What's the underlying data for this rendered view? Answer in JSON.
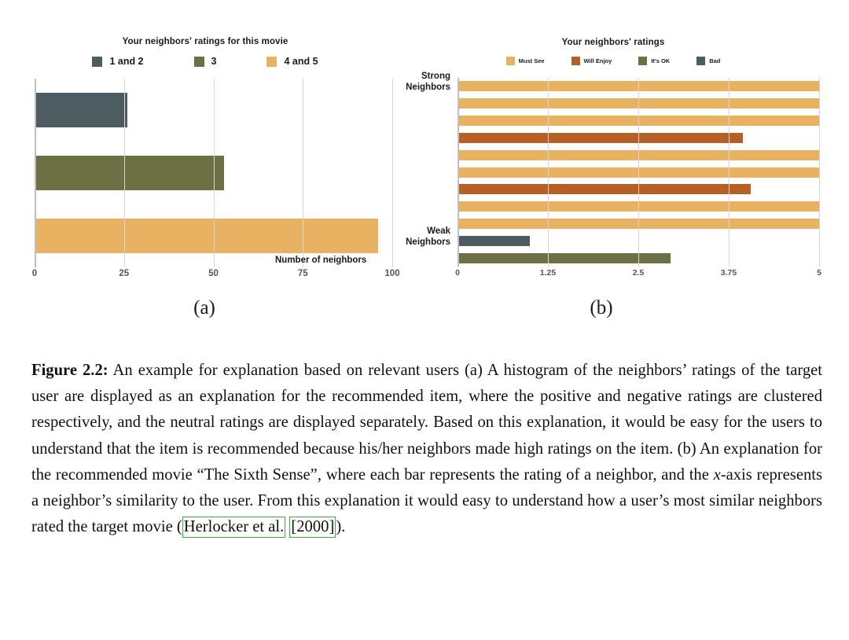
{
  "figure": {
    "sublabel_a": "(a)",
    "sublabel_b": "(b)"
  },
  "colors": {
    "must_see_tan": "#e8b262",
    "will_enjoy_orange": "#b65f26",
    "its_ok_olive": "#6d7043",
    "bad_slate": "#4c5c60",
    "gridline": "#d6d6d6",
    "axis": "#bfbfbf",
    "tick_text": "#555555",
    "cite_box": "#3fae3f"
  },
  "chart_data": [
    {
      "type": "bar",
      "orientation": "horizontal",
      "title": "Your neighbors' ratings for this movie",
      "xlabel": "Number of neighbors",
      "ylabel": "",
      "xlim": [
        0,
        100
      ],
      "xticks": [
        "0",
        "25",
        "50",
        "75",
        "100"
      ],
      "xtick_values": [
        0,
        25,
        50,
        75,
        100
      ],
      "grid": true,
      "legend_position": "top",
      "categories": [
        "1 and 2",
        "3",
        "4 and 5"
      ],
      "values": [
        26,
        53,
        96
      ],
      "colors": [
        "#4c5c60",
        "#6d7043",
        "#e8b262"
      ],
      "legend": [
        {
          "label": "1 and 2",
          "color": "#4c5c60"
        },
        {
          "label": "3",
          "color": "#6d7043"
        },
        {
          "label": "4 and 5",
          "color": "#e8b262"
        }
      ]
    },
    {
      "type": "bar",
      "orientation": "horizontal",
      "title": "Your neighbors'  ratings",
      "xlabel": "",
      "ylabel": "",
      "xlim": [
        0,
        5
      ],
      "xticks": [
        "0",
        "1.25",
        "2.5",
        "3.75",
        "5"
      ],
      "xtick_values": [
        0,
        1.25,
        2.5,
        3.75,
        5
      ],
      "grid": true,
      "legend_position": "top",
      "ycategory_labels": [
        {
          "label": "Strong\nNeighbors",
          "bar_index": 0
        },
        {
          "label": "Weak\nNeighbors",
          "bar_index": 9
        }
      ],
      "bars": [
        {
          "value": 5.0,
          "series": "Must See",
          "color": "#e8b262"
        },
        {
          "value": 5.0,
          "series": "Must See",
          "color": "#e8b262"
        },
        {
          "value": 5.0,
          "series": "Must See",
          "color": "#e8b262"
        },
        {
          "value": 3.95,
          "series": "Will Enjoy",
          "color": "#b65f26"
        },
        {
          "value": 5.0,
          "series": "Must See",
          "color": "#e8b262"
        },
        {
          "value": 5.0,
          "series": "Must See",
          "color": "#e8b262"
        },
        {
          "value": 4.05,
          "series": "Will Enjoy",
          "color": "#b65f26"
        },
        {
          "value": 5.0,
          "series": "Must See",
          "color": "#e8b262"
        },
        {
          "value": 5.0,
          "series": "Must See",
          "color": "#e8b262"
        },
        {
          "value": 1.0,
          "series": "Bad",
          "color": "#4c5c60"
        },
        {
          "value": 2.95,
          "series": "It's OK",
          "color": "#6d7043"
        }
      ],
      "legend": [
        {
          "label": "Must See",
          "color": "#e8b262"
        },
        {
          "label": "Will Enjoy",
          "color": "#b65f26"
        },
        {
          "label": "It's OK",
          "color": "#6d7043"
        },
        {
          "label": "Bad",
          "color": "#4c5c60"
        }
      ]
    }
  ],
  "caption": {
    "label": "Figure 2.2:",
    "text_before_cite": " An example for explanation based on relevant users (a) A histogram of the neighbors’ ratings of the target user are displayed as an explanation for the recommended item, where the positive and negative ratings are clustered respectively, and the neutral ratings are displayed separately. Based on this explanation, it would be easy for the users to understand that the item is recommended because his/her neighbors made high ratings on the item. (b) An explanation for the recommended movie “The Sixth Sense”, where each bar represents the rating of a neighbor, and the ",
    "math_x": "x",
    "text_mid": "-axis represents a neighbor’s similarity to the user. From this explanation it would easy to understand how a user’s most similar neighbors rated the target movie (",
    "cite_author": "Herlocker et al.",
    "cite_year": "[2000]",
    "text_after_cite": ")."
  }
}
